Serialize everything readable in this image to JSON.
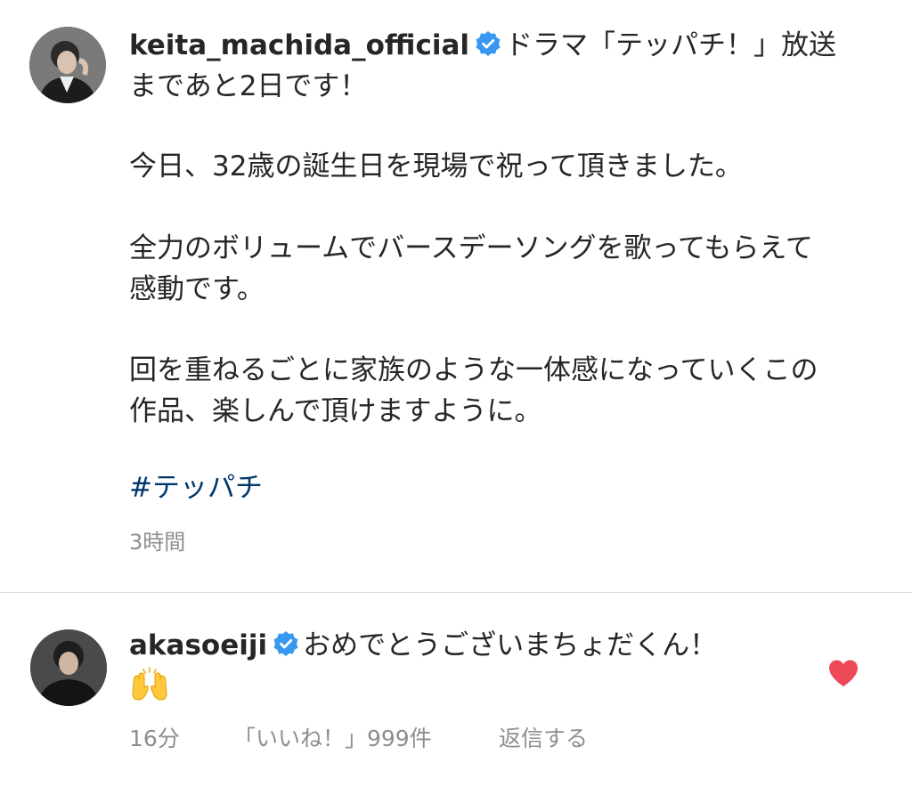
{
  "post": {
    "username": "keita_machida_official",
    "verified_icon": "verified-badge-icon",
    "caption_lines": [
      "ドラマ「テッパチ！」放送",
      "まであと2日です！",
      "今日、32歳の誕生日を現場で祝って頂きました。",
      "全力のボリュームでバースデーソングを歌ってもらえて",
      "感動です。",
      "回を重ねるごとに家族のような一体感になっていくこの",
      "作品、楽しんで頂けますように。"
    ],
    "hashtag": "#テッパチ",
    "time": "3時間"
  },
  "comment": {
    "username": "akasoeiji",
    "verified_icon": "verified-badge-icon",
    "text": "おめでとうございまちょだくん！",
    "emoji_icon": "raising-hands-emoji-icon",
    "liked": true,
    "heart_color": "#ed4956",
    "time": "16分",
    "likes": "「いいね！」999件",
    "reply": "返信する"
  },
  "colors": {
    "text": "#262626",
    "secondary": "#8e8e8e",
    "hashtag": "#00376b",
    "verified": "#3897f0",
    "divider": "#dbdbdb"
  }
}
